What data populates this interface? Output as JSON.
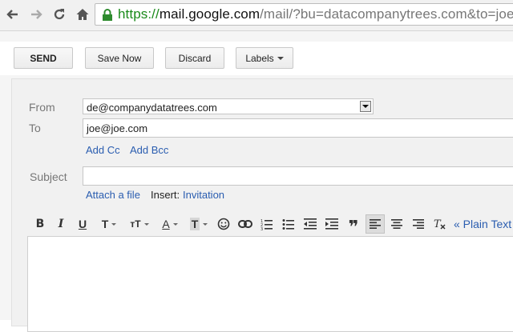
{
  "browser": {
    "url_scheme": "https://",
    "url_host": "mail.google.com",
    "url_rest": "/mail/?bu=datacompanytrees.com&to=joe@j"
  },
  "toolbar": {
    "send_label": "SEND",
    "save_label": "Save Now",
    "discard_label": "Discard",
    "labels_label": "Labels"
  },
  "compose": {
    "from_label": "From",
    "from_value": "de@companydatatrees.com",
    "to_label": "To",
    "to_value": "joe@joe.com",
    "add_cc": "Add Cc",
    "add_bcc": "Add Bcc",
    "subject_label": "Subject",
    "subject_value": "",
    "attach_label": "Attach a file",
    "insert_label": "Insert:",
    "invitation_label": "Invitation"
  },
  "format": {
    "bold": "B",
    "italic": "I",
    "underline": "U",
    "font": "T",
    "size": "тT",
    "text_color": "A",
    "bg_color": "T",
    "plain_text": "« Plain Text"
  },
  "colors": {
    "link": "#2a5db0",
    "secure_green": "#1a8a1a"
  }
}
